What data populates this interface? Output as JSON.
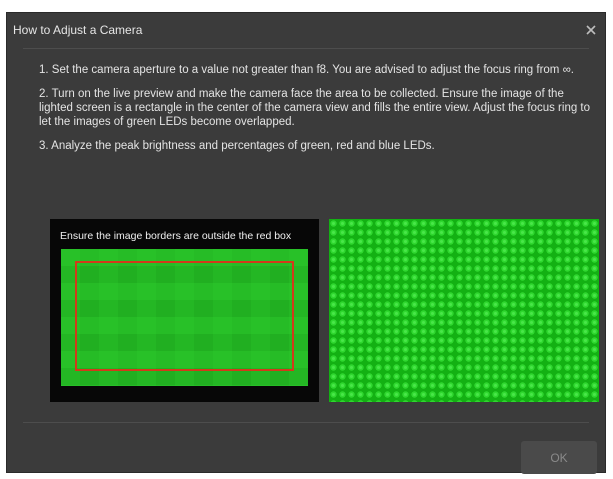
{
  "dialog": {
    "title": "How to Adjust a Camera",
    "close_glyph": "×",
    "close_icon": "close-icon",
    "steps": [
      "1. Set the camera aperture to a value not greater than f8. You are advised to adjust the focus ring from ∞.",
      "2. Turn on the live preview and make the camera face the area to be collected. Ensure the image of the lighted screen is a rectangle in the center of the camera view and fills the entire view. Adjust the focus ring to let the images of green LEDs become overlapped.",
      "3. Analyze the peak brightness and percentages of green, red and blue LEDs."
    ],
    "preview_left_caption": "Ensure the image borders are outside the red box",
    "ok_label": "OK"
  },
  "colors": {
    "dialog_bg": "#3b3b3b",
    "text": "#e4e4e4",
    "led_green": "#1fc21f",
    "frame_red": "#d23a1a",
    "button_bg": "#4a4a4a",
    "button_text": "#8a8a8a"
  }
}
